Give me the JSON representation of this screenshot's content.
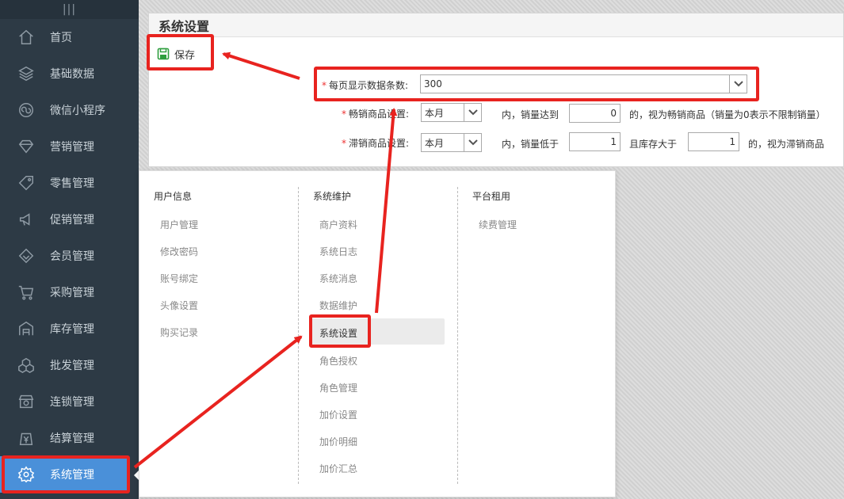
{
  "sidebar": {
    "items": [
      {
        "label": "首页",
        "icon": "home-icon"
      },
      {
        "label": "基础数据",
        "icon": "layers-icon"
      },
      {
        "label": "微信小程序",
        "icon": "miniprogram-icon"
      },
      {
        "label": "营销管理",
        "icon": "diamond-icon"
      },
      {
        "label": "零售管理",
        "icon": "tag-icon"
      },
      {
        "label": "促销管理",
        "icon": "megaphone-icon"
      },
      {
        "label": "会员管理",
        "icon": "diamond-member-icon"
      },
      {
        "label": "采购管理",
        "icon": "cart-icon"
      },
      {
        "label": "库存管理",
        "icon": "warehouse-icon"
      },
      {
        "label": "批发管理",
        "icon": "boxes-icon"
      },
      {
        "label": "连锁管理",
        "icon": "store-icon"
      },
      {
        "label": "结算管理",
        "icon": "yen-bag-icon"
      },
      {
        "label": "系统管理",
        "icon": "gear-icon",
        "active": true
      }
    ]
  },
  "page": {
    "title": "系统设置",
    "save_label": "保存",
    "rows_per_page_label": "每页显示数据条数:",
    "rows_per_page_value": "300",
    "hot_label": "畅销商品设置:",
    "hot_period": "本月",
    "hot_text1": "内，销量达到",
    "hot_value": "0",
    "hot_text2": "的，视为畅销商品（销量为0表示不限制销量）",
    "slow_label": "滞销商品设置:",
    "slow_period": "本月",
    "slow_text1": "内，销量低于",
    "slow_value": "1",
    "slow_text2": "且库存大于",
    "slow_stock_value": "1",
    "slow_text3": "的，视为滞销商品"
  },
  "menu": {
    "columns": [
      {
        "title": "用户信息",
        "items": [
          "用户管理",
          "修改密码",
          "账号绑定",
          "头像设置",
          "购买记录"
        ]
      },
      {
        "title": "系统维护",
        "items": [
          "商户资料",
          "系统日志",
          "系统消息",
          "数据维护",
          "系统设置",
          "角色授权",
          "角色管理",
          "加价设置",
          "加价明细",
          "加价汇总"
        ]
      },
      {
        "title": "平台租用",
        "items": [
          "续费管理"
        ]
      }
    ],
    "selected": "系统设置"
  },
  "colors": {
    "sidebar_bg": "#2d3a45",
    "active_bg": "#4a90d9",
    "annotation_red": "#e8231f",
    "required_star": "#e33",
    "save_icon_green": "#2e9e3e"
  }
}
